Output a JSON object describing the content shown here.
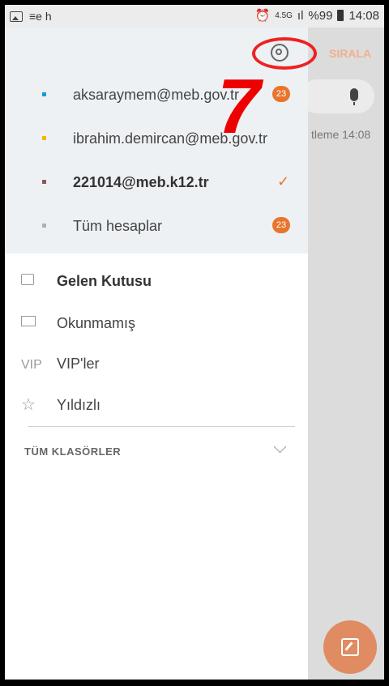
{
  "status_bar": {
    "left_text": "≡e  h",
    "network": "4.5G",
    "battery": "%99",
    "time": "14:08"
  },
  "background": {
    "sort_label": "SIRALA",
    "update_text": "tleme 14:08"
  },
  "accounts": [
    {
      "label": "aksaraymem@meb.gov.tr",
      "color": "#1a9bd7",
      "badge": "23"
    },
    {
      "label": "ibrahim.demircan@meb.gov.tr",
      "color": "#f2b705",
      "badge": ""
    },
    {
      "label": "221014@meb.k12.tr",
      "color": "#8a5a5a",
      "badge": "",
      "selected": true
    },
    {
      "label": "Tüm hesaplar",
      "color": "#b0b0b0",
      "badge": "23"
    }
  ],
  "annotation": {
    "number": "7"
  },
  "folders": [
    {
      "label": "Gelen Kutusu",
      "icon": "inbox-icon"
    },
    {
      "label": "Okunmamış",
      "icon": "mail-icon"
    },
    {
      "label": "VIP'ler",
      "icon": "VIP"
    },
    {
      "label": "Yıldızlı",
      "icon": "☆"
    }
  ],
  "all_folders_label": "TÜM KLASÖRLER"
}
